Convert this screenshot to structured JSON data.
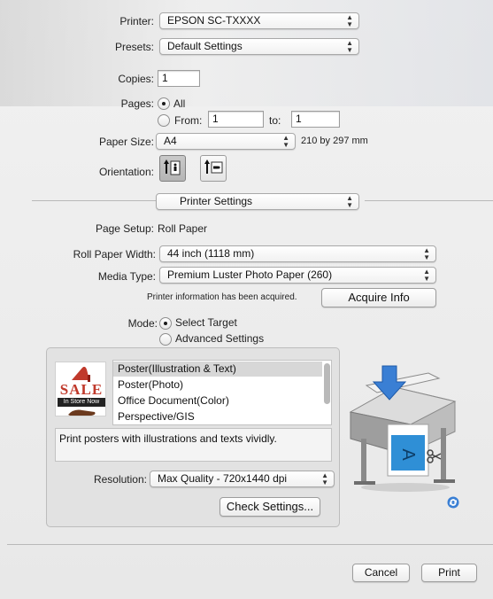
{
  "printer": {
    "label": "Printer:",
    "value": "EPSON SC-TXXXX"
  },
  "presets": {
    "label": "Presets:",
    "value": "Default Settings"
  },
  "copies": {
    "label": "Copies:",
    "value": "1"
  },
  "pages": {
    "label": "Pages:",
    "all_label": "All",
    "from_label": "From:",
    "from_value": "1",
    "to_label": "to:",
    "to_value": "1",
    "selected": "All"
  },
  "paper_size": {
    "label": "Paper Size:",
    "value": "A4",
    "dimensions": "210 by 297 mm"
  },
  "orientation": {
    "label": "Orientation:",
    "selected": "portrait"
  },
  "section_popup": {
    "value": "Printer Settings"
  },
  "page_setup": {
    "label": "Page Setup:",
    "value": "Roll Paper"
  },
  "roll_paper_width": {
    "label": "Roll Paper Width:",
    "value": "44 inch (1118 mm)"
  },
  "media_type": {
    "label": "Media Type:",
    "value": "Premium Luster Photo Paper (260)"
  },
  "printer_info": {
    "text": "Printer information has been acquired.",
    "button": "Acquire Info"
  },
  "mode": {
    "label": "Mode:",
    "options": [
      "Select Target",
      "Advanced Settings"
    ],
    "selected": "Select Target"
  },
  "targets": {
    "items": [
      "Poster(Illustration & Text)",
      "Poster(Photo)",
      "Office Document(Color)",
      "Perspective/GIS"
    ],
    "selected": "Poster(Illustration & Text)",
    "description": "Print posters with illustrations and texts vividly."
  },
  "sale_image": {
    "sale": "SALE",
    "tag": "In Store Now"
  },
  "resolution": {
    "label": "Resolution:",
    "value": "Max Quality - 720x1440 dpi"
  },
  "check_settings_button": "Check Settings...",
  "footer": {
    "cancel": "Cancel",
    "print": "Print"
  },
  "colors": {
    "accent_blue": "#3a7fd4",
    "sale_red": "#c0392b"
  },
  "icons": [
    "popup-arrows-icon",
    "portrait-icon",
    "landscape-icon",
    "printer-illustration-icon",
    "refresh-icon"
  ]
}
